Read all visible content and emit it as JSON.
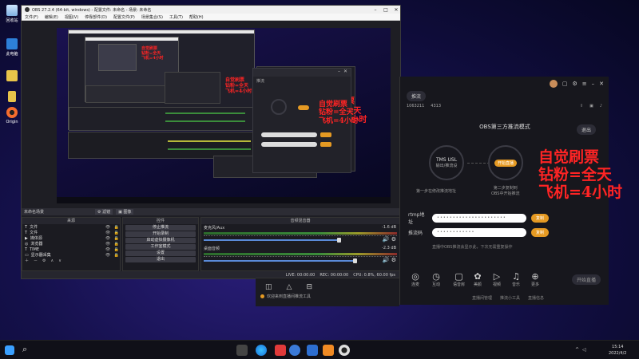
{
  "desktop_icons": [
    {
      "label": "回收站",
      "icon": "recycle-bin-icon"
    },
    {
      "label": "此电脑",
      "icon": "computer-icon"
    },
    {
      "label": "",
      "icon": "folder-icon"
    },
    {
      "label": "",
      "icon": "app-icon"
    },
    {
      "label": "Origin",
      "icon": "origin-icon"
    }
  ],
  "obs": {
    "title": "OBS 27.2.4 (64-bit, windows) - 配置文件: 未命名 - 场景: 未命名",
    "menu": [
      "文件(F)",
      "编辑(E)",
      "视图(V)",
      "停靠部件(D)",
      "配置文件(P)",
      "场景集合(S)",
      "工具(T)",
      "帮助(H)"
    ],
    "scene_bar": "未命名场景",
    "filters_btn": "滤镜",
    "image_btn": "图像",
    "sources_header": "来源",
    "controls_header": "控件",
    "mixer_header": "音频混音器",
    "sources": [
      "文件",
      "文件",
      "媒体源",
      "浏览器",
      "TIME",
      "显示器采集"
    ],
    "controls": [
      "停止推流",
      "开始录制",
      "启动虚拟摄像机",
      "工作室模式",
      "设置",
      "退出"
    ],
    "mixer": [
      {
        "name": "麦克风/Aux",
        "db": "-1.6 dB"
      },
      {
        "name": "桌面音频",
        "db": "-2.3 dB"
      }
    ],
    "status": [
      "LIVE: 00:00:00",
      "REC: 00:00:00",
      "CPU: 0.8%, 60.00 fps"
    ]
  },
  "notes": {
    "line1": "自觉刷票",
    "line2": "钻粉=全天",
    "line3": "飞机=4小时"
  },
  "tool": {
    "tab_label": "推流",
    "id_text": "1063211",
    "fans": "4313",
    "mode_title": "OBS第三方推流模式",
    "exit_btn": "退出",
    "step1_title": "TMS USL",
    "step1_sub": "输出/推流设",
    "step1_desc": "第一步在修改推流地址",
    "step2_btn": "开始直播",
    "step2_desc": "第二步复制到",
    "step2_desc2": "OBS中开始推流",
    "rtmp_label": "rtmp地址",
    "rtmp_value": "••••••••••••••••••••••",
    "key_label": "推流码",
    "key_value": "••••••••••••",
    "copy_btn": "复制",
    "hint": "直播中OBS推流会显示此，下次无需重复操作",
    "bottom_tools": [
      "连麦",
      "互动",
      "语音房",
      "美颜",
      "视频",
      "音乐",
      "更多"
    ],
    "live_btn": "开始直播",
    "footer_links": [
      "直播间管理",
      "推流小工具",
      "直播信息"
    ]
  },
  "float": {
    "bar_text": "推流",
    "note1": "自觉刷票",
    "note2": "钻粉=全天",
    "note3": "飞机=4小时"
  },
  "popup": {
    "text": "欢迎来到直播间推流工具"
  },
  "taskbar": {
    "time": "15:14",
    "date": "2022/4/2"
  }
}
